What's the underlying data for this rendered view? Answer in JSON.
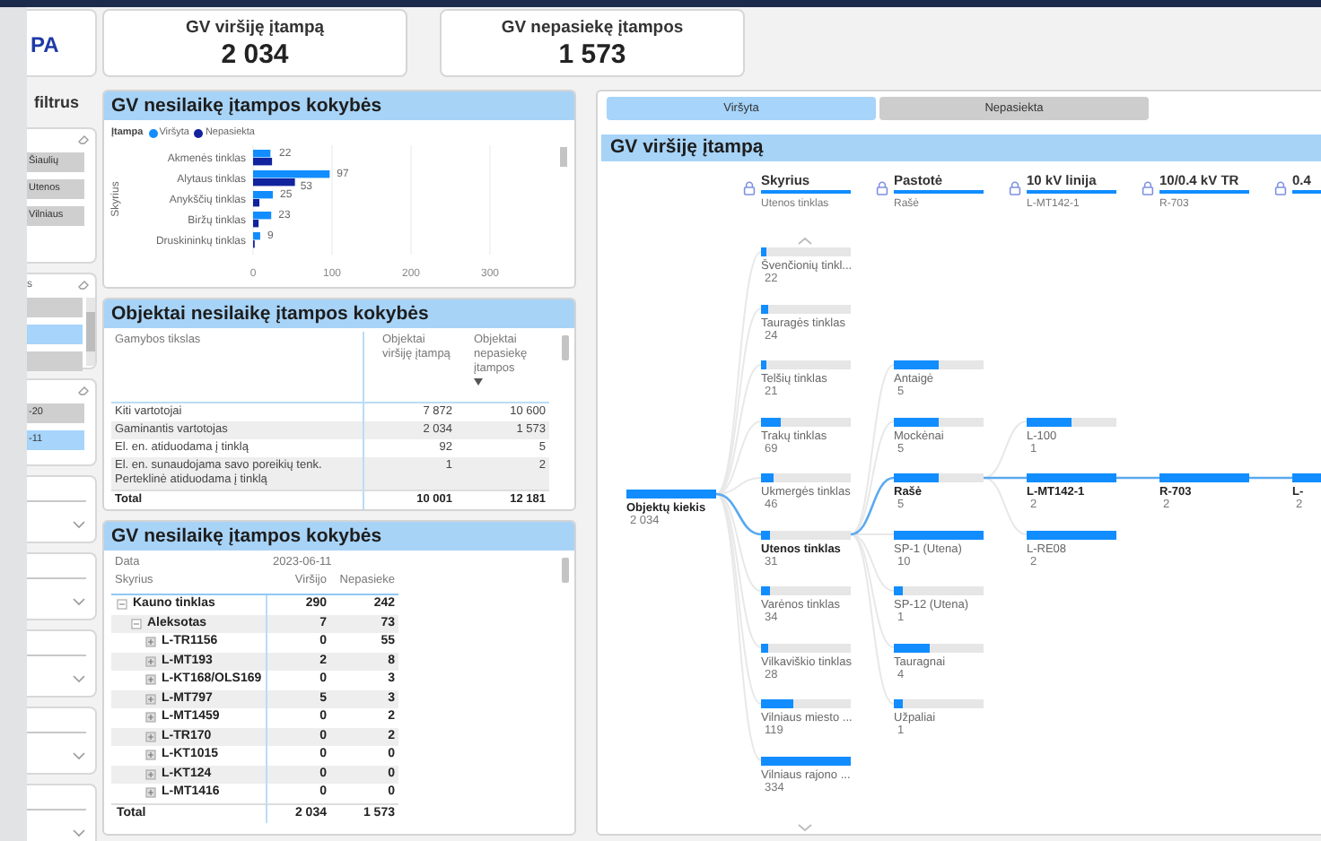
{
  "sidebar": {
    "logo_text": "PA",
    "filter_label": "filtrus",
    "slicers": [
      {
        "kind": "chips",
        "items": [
          {
            "label": "Šiaulių",
            "selected": false
          },
          {
            "label": "Utenos",
            "selected": false
          },
          {
            "label": "Vilniaus",
            "selected": false
          }
        ]
      },
      {
        "kind": "chips",
        "title": "s",
        "scrollable": true,
        "items": [
          {
            "selected": false
          },
          {
            "selected": true
          },
          {
            "selected": false
          }
        ]
      },
      {
        "kind": "chips",
        "items": [
          {
            "label": "-20",
            "selected": false
          },
          {
            "label": "-11",
            "selected": true
          }
        ]
      },
      {
        "kind": "dropdown",
        "expanded": false
      },
      {
        "kind": "dropdown",
        "expanded": false
      },
      {
        "kind": "dropdown",
        "expanded": false
      },
      {
        "kind": "dropdown",
        "expanded": false
      },
      {
        "kind": "dropdown",
        "expanded": false
      }
    ]
  },
  "kpis": [
    {
      "title": "GV viršiję įtampą",
      "value": "2 034"
    },
    {
      "title": "GV nepasiekę įtampos",
      "value": "1 573"
    }
  ],
  "bar_chart_panel": {
    "title": "GV nesilaikę įtampos kokybės",
    "legend_title": "Įtampa",
    "chart_data": {
      "type": "bar",
      "orientation": "horizontal",
      "ylabel": "Skyrius",
      "categories": [
        "Akmenės tinklas",
        "Alytaus tinklas",
        "Anykščių tinklas",
        "Biržų tinklas",
        "Druskininkų tinklas"
      ],
      "series": [
        {
          "name": "Viršyta",
          "color": "#118dff",
          "values": [
            22,
            97,
            25,
            23,
            9
          ]
        },
        {
          "name": "Nepasiekta",
          "color": "#12239e",
          "values": [
            24,
            53,
            8,
            7,
            2
          ]
        }
      ],
      "value_labels": [
        [
          "22",
          "97",
          "25",
          "23",
          "9"
        ],
        [
          null,
          "53",
          null,
          null,
          null
        ]
      ],
      "grid": true,
      "xlim": [
        0,
        300
      ],
      "xticks": [
        0,
        100,
        200,
        300
      ]
    }
  },
  "table_panel": {
    "title": "Objektai nesilaikę įtampos kokybės",
    "columns": [
      {
        "label": "Gamybos tikslas",
        "sorted": false
      },
      {
        "label": "Objektai viršiję įtampą",
        "sorted": false
      },
      {
        "label": "Objektai nepasiekę įtampos",
        "sorted": true
      }
    ],
    "rows": [
      [
        "Kiti vartotojai",
        "7 872",
        "10 600"
      ],
      [
        "Gaminantis vartotojas",
        "2 034",
        "1 573"
      ],
      [
        "El. en. atiduodama į tinklą",
        "92",
        "5"
      ],
      [
        "El. en. sunaudojama savo poreikių tenk. Perteklinė atiduodama į tinklą",
        "1",
        "2"
      ]
    ],
    "total": [
      "Total",
      "10 001",
      "12 181"
    ]
  },
  "matrix_panel": {
    "title": "GV nesilaikę įtampos kokybės",
    "column_group": {
      "label": "Data",
      "value": "2023-06-11"
    },
    "columns": [
      "Skyrius",
      "Viršijo",
      "Nepasieke"
    ],
    "rows": [
      {
        "label": "Kauno tinklas",
        "values": [
          "290",
          "242"
        ],
        "expanded": true,
        "children": [
          {
            "label": "Aleksotas",
            "values": [
              "7",
              "73"
            ],
            "expanded": true,
            "children": [
              {
                "label": "L-TR1156",
                "values": [
                  "0",
                  "55"
                ],
                "expanded": false
              },
              {
                "label": "L-MT193",
                "values": [
                  "2",
                  "8"
                ],
                "expanded": false
              },
              {
                "label": "L-KT168/OLS169",
                "values": [
                  "0",
                  "3"
                ],
                "expanded": false
              },
              {
                "label": "L-MT797",
                "values": [
                  "5",
                  "3"
                ],
                "expanded": false
              },
              {
                "label": "L-MT1459",
                "values": [
                  "0",
                  "2"
                ],
                "expanded": false
              },
              {
                "label": "L-TR170",
                "values": [
                  "0",
                  "2"
                ],
                "expanded": false
              },
              {
                "label": "L-KT1015",
                "values": [
                  "0",
                  "0"
                ],
                "expanded": false
              },
              {
                "label": "L-KT124",
                "values": [
                  "0",
                  "0"
                ],
                "expanded": false
              },
              {
                "label": "L-MT1416",
                "values": [
                  "0",
                  "0"
                ],
                "expanded": false
              }
            ]
          }
        ]
      }
    ],
    "total": {
      "label": "Total",
      "values": [
        "2 034",
        "1 573"
      ]
    }
  },
  "tree_panel": {
    "tabs": [
      {
        "label": "Viršyta",
        "selected": true
      },
      {
        "label": "Nepasiekta",
        "selected": false
      }
    ],
    "title": "GV viršiję įtampą",
    "tree": {
      "root": {
        "label": "Objektų kiekis",
        "value": "2 034",
        "level": 1
      },
      "levels": [
        {
          "title": "Skyrius",
          "filter": "Utenos tinklas",
          "locked": true,
          "can_scroll_up": true,
          "can_scroll_down": true,
          "items": [
            {
              "label": "Švenčionių tinkl...",
              "value": "22",
              "level": 0.066,
              "selected": false
            },
            {
              "label": "Tauragės tinklas",
              "value": "24",
              "level": 0.072,
              "selected": false
            },
            {
              "label": "Telšių tinklas",
              "value": "21",
              "level": 0.063,
              "selected": false
            },
            {
              "label": "Trakų tinklas",
              "value": "69",
              "level": 0.21,
              "selected": false
            },
            {
              "label": "Ukmergės tinklas",
              "value": "46",
              "level": 0.14,
              "selected": false
            },
            {
              "label": "Utenos tinklas",
              "value": "31",
              "level": 0.093,
              "selected": true
            },
            {
              "label": "Varėnos tinklas",
              "value": "34",
              "level": 0.1,
              "selected": false
            },
            {
              "label": "Vilkaviškio tinklas",
              "value": "28",
              "level": 0.084,
              "selected": false
            },
            {
              "label": "Vilniaus miesto ...",
              "value": "119",
              "level": 0.36,
              "selected": false
            },
            {
              "label": "Vilniaus rajono ...",
              "value": "334",
              "level": 1,
              "selected": false
            }
          ]
        },
        {
          "title": "Pastotė",
          "filter": "Rašė",
          "locked": true,
          "items": [
            {
              "label": "Antaigė",
              "value": "5",
              "level": 0.5,
              "selected": false
            },
            {
              "label": "Mockėnai",
              "value": "5",
              "level": 0.5,
              "selected": false
            },
            {
              "label": "Rašė",
              "value": "5",
              "level": 0.5,
              "selected": true
            },
            {
              "label": "SP-1 (Utena)",
              "value": "10",
              "level": 1,
              "selected": false
            },
            {
              "label": "SP-12 (Utena)",
              "value": "1",
              "level": 0.1,
              "selected": false
            },
            {
              "label": "Tauragnai",
              "value": "4",
              "level": 0.4,
              "selected": false
            },
            {
              "label": "Užpaliai",
              "value": "1",
              "level": 0.1,
              "selected": false
            }
          ]
        },
        {
          "title": "10 kV linija",
          "filter": "L-MT142-1",
          "locked": true,
          "items": [
            {
              "label": "L-100",
              "value": "1",
              "level": 0.5,
              "selected": false
            },
            {
              "label": "L-MT142-1",
              "value": "2",
              "level": 1,
              "selected": true
            },
            {
              "label": "L-RE08",
              "value": "2",
              "level": 1,
              "selected": false
            }
          ]
        },
        {
          "title": "10/0.4 kV TR",
          "filter": "R-703",
          "locked": true,
          "items": [
            {
              "label": "R-703",
              "value": "2",
              "level": 1,
              "selected": true
            }
          ]
        },
        {
          "title": "0.4",
          "locked": true,
          "items": [
            {
              "label": "L-",
              "value": "2",
              "level": 1,
              "selected": true
            }
          ]
        }
      ]
    }
  }
}
